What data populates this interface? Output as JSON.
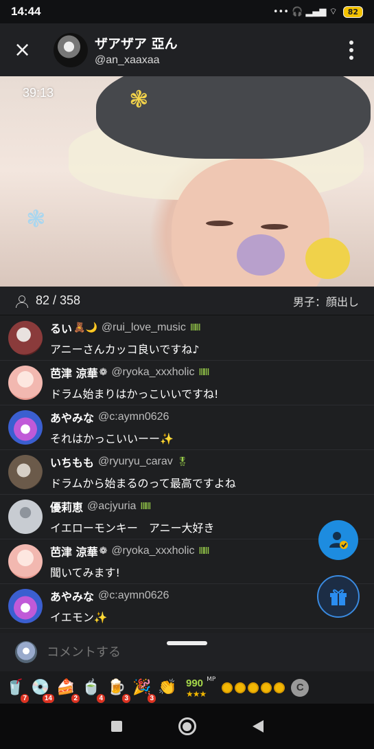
{
  "status_bar": {
    "time": "14:44",
    "signal_icons": "••• 🎧 ▂▄▆ ⌔",
    "battery": "82"
  },
  "header": {
    "close_icon": "×",
    "host_name": "ザアザア 亞ん",
    "host_handle": "@an_xaaxaa"
  },
  "video": {
    "timer": "39:13"
  },
  "viewer_bar": {
    "viewer_count": "82 / 358",
    "stream_title": "男子：顔出し"
  },
  "comments": [
    {
      "name": "るい",
      "emoji": "🧸🌙",
      "handle": "@rui_love_music",
      "badge": "ⅢⅢ",
      "text": "アニーさんカッコ良いですね♪",
      "avatar_color": "#8a3b3b"
    },
    {
      "name": "芭津 涼華",
      "emoji": "❁",
      "handle": "@ryoka_xxxholic",
      "badge": "ⅢⅢ",
      "text": "ドラム始まりはかっこいいですね!",
      "avatar_color": "#f2b8b0"
    },
    {
      "name": "あやみな",
      "emoji": "",
      "handle": "@c:aymn0626",
      "badge": "",
      "text": "それはかっこいいーー✨",
      "avatar_color": "#5a4fcf"
    },
    {
      "name": "いちもも",
      "emoji": "",
      "handle": "@ryuryu_carav",
      "badge": "🎖",
      "text": "ドラムから始まるのって最高ですよね",
      "avatar_color": "#6b5a4a"
    },
    {
      "name": "優莉恵",
      "emoji": "",
      "handle": "@acjyuria",
      "badge": "ⅢⅢ",
      "text": "イエローモンキー　アニー大好き",
      "avatar_color": "#c8ccd2"
    },
    {
      "name": "芭津 涼華",
      "emoji": "❁",
      "handle": "@ryoka_xxxholic",
      "badge": "ⅢⅢ",
      "text": "聞いてみます!",
      "avatar_color": "#f2b8b0"
    },
    {
      "name": "あやみな",
      "emoji": "",
      "handle": "@c:aymn0626",
      "badge": "",
      "text": "イエモン✨",
      "avatar_color": "#5a4fcf"
    }
  ],
  "comment_bar": {
    "placeholder": "コメントする"
  },
  "gift_bar": {
    "gifts": [
      {
        "icon": "🥤",
        "count": "7"
      },
      {
        "icon": "💿",
        "count": "14"
      },
      {
        "icon": "🍰",
        "count": "2"
      },
      {
        "icon": "🍵",
        "count": "4"
      },
      {
        "icon": "🍺",
        "count": "3"
      },
      {
        "icon": "🎉",
        "count": "3"
      }
    ],
    "clap_icon": "👏",
    "mp_value": "990",
    "mp_unit": "MP",
    "mp_stars": "★★★",
    "coin_label": "C"
  },
  "colors": {
    "accent": "#1d8ce0",
    "badge_green": "#9ad04a",
    "mp_green": "#a6d84a"
  }
}
